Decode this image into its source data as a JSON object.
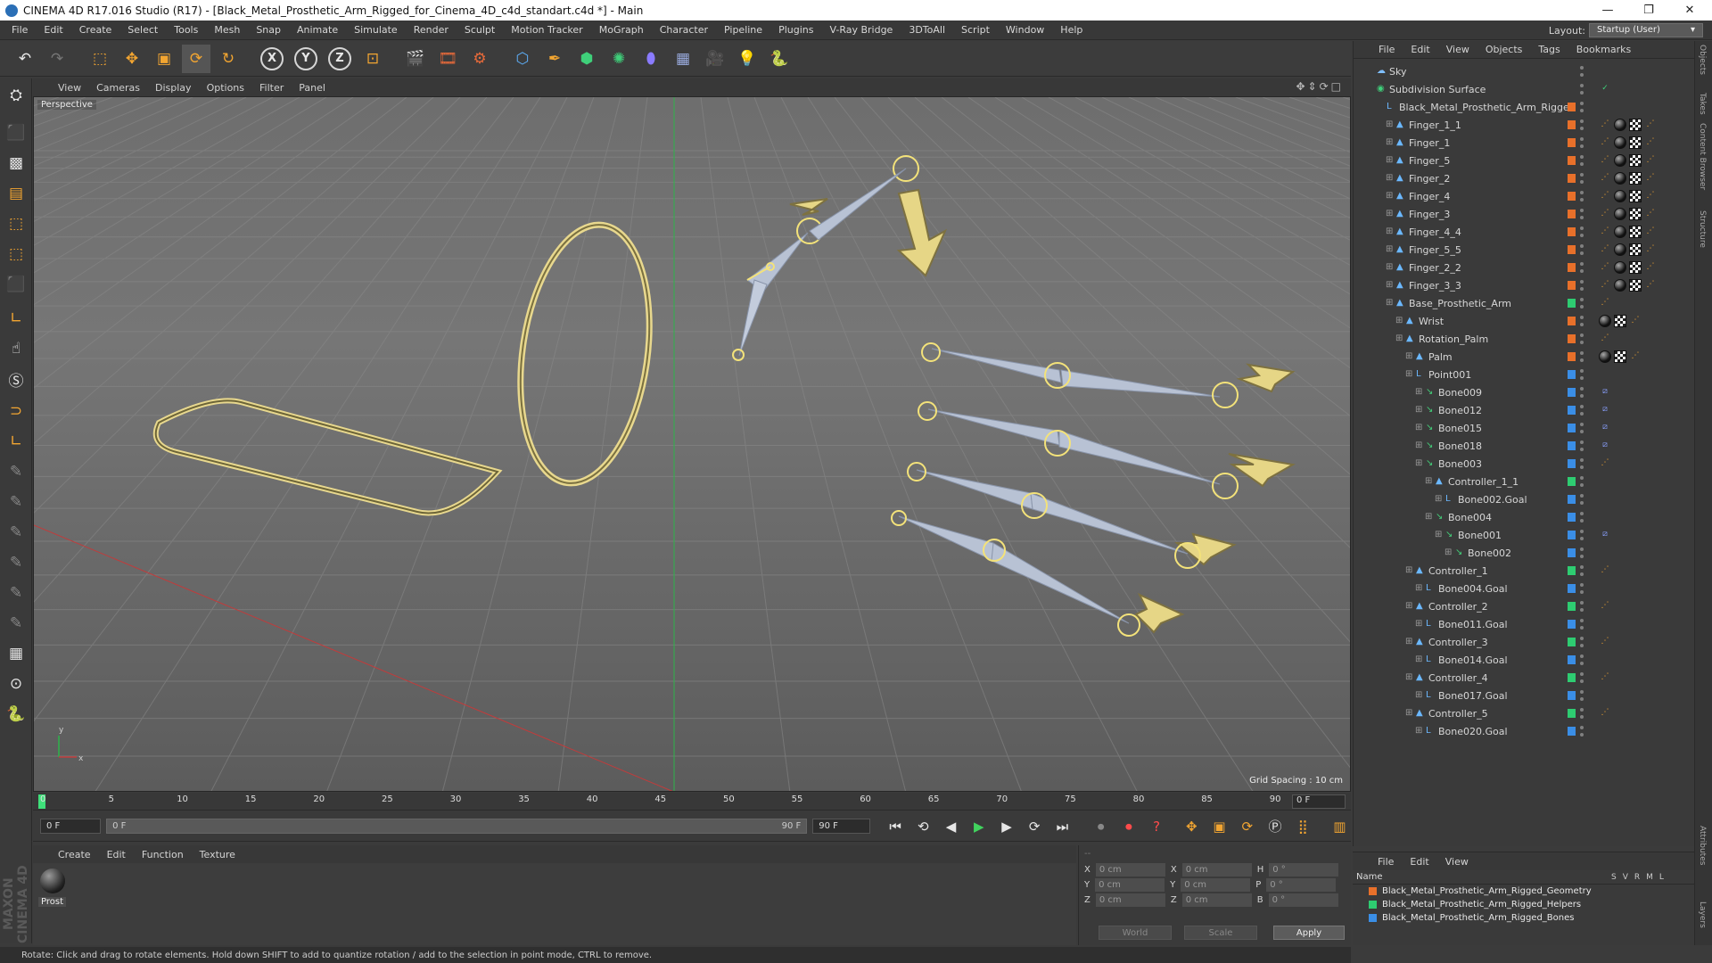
{
  "window": {
    "title": "CINEMA 4D R17.016 Studio (R17) - [Black_Metal_Prosthetic_Arm_Rigged_for_Cinema_4D_c4d_standart.c4d *] - Main",
    "controls": [
      "—",
      "❐",
      "✕"
    ]
  },
  "menubar": [
    "File",
    "Edit",
    "Create",
    "Select",
    "Tools",
    "Mesh",
    "Snap",
    "Animate",
    "Simulate",
    "Render",
    "Sculpt",
    "Motion Tracker",
    "MoGraph",
    "Character",
    "Pipeline",
    "Plugins",
    "V-Ray Bridge",
    "3DToAll",
    "Script",
    "Window",
    "Help"
  ],
  "layout": {
    "label": "Layout:",
    "value": "Startup (User)"
  },
  "toolbar": {
    "icons": [
      "undo-icon",
      "redo-icon",
      "select-icon",
      "move-icon",
      "scale-icon",
      "rotate-icon",
      "rotate-alt-icon",
      "x-axis-icon",
      "y-axis-icon",
      "z-axis-icon",
      "coordinate-system-icon",
      "render-view-icon",
      "render-picture-viewer-icon",
      "render-settings-icon",
      "cube-icon",
      "pen-icon",
      "subdivide-icon",
      "array-icon",
      "deformer-icon",
      "floor-icon",
      "camera-icon",
      "light-icon",
      "python-icon"
    ],
    "axis": {
      "x": "X",
      "y": "Y",
      "z": "Z"
    }
  },
  "viewport_menu": [
    "View",
    "Cameras",
    "Display",
    "Options",
    "Filter",
    "Panel"
  ],
  "viewport": {
    "label": "Perspective",
    "grid_spacing": "Grid Spacing : 10 cm"
  },
  "timeline": {
    "ticks": [
      "0",
      "5",
      "10",
      "15",
      "20",
      "25",
      "30",
      "35",
      "40",
      "45",
      "50",
      "55",
      "60",
      "65",
      "70",
      "75",
      "80",
      "85",
      "90"
    ],
    "current": "0 F"
  },
  "transport": {
    "start": "0 F",
    "slider_start": "0 F",
    "slider_end": "90 F",
    "end": "90 F"
  },
  "material_menu": [
    "Create",
    "Edit",
    "Function",
    "Texture"
  ],
  "material": {
    "name": "Prost"
  },
  "coords": {
    "rows": [
      {
        "a": "X",
        "av": "0 cm",
        "b": "X",
        "bv": "0 cm",
        "c": "H",
        "cv": "0 °"
      },
      {
        "a": "Y",
        "av": "0 cm",
        "b": "Y",
        "bv": "0 cm",
        "c": "P",
        "cv": "0 °"
      },
      {
        "a": "Z",
        "av": "0 cm",
        "b": "Z",
        "bv": "0 cm",
        "c": "B",
        "cv": "0 °"
      }
    ],
    "space": "World",
    "mode": "Scale",
    "apply": "Apply",
    "header": "--"
  },
  "status": "Rotate: Click and drag to rotate elements. Hold down SHIFT to add to quantize rotation / add to the selection in point mode, CTRL to remove.",
  "object_manager": {
    "menu": [
      "File",
      "Edit",
      "View",
      "Objects",
      "Tags",
      "Bookmarks"
    ],
    "rows": [
      {
        "name": "Sky",
        "depth": 0,
        "type": "sky",
        "layer": "",
        "tags": []
      },
      {
        "name": "Subdivision Surface",
        "depth": 0,
        "type": "sds",
        "layer": "",
        "tags": [
          "check"
        ]
      },
      {
        "name": "Black_Metal_Prosthetic_Arm_Rigged",
        "depth": 1,
        "type": "null",
        "layer": "#e8702a",
        "tags": []
      },
      {
        "name": "Finger_1_1",
        "depth": 2,
        "type": "joint",
        "layer": "#e8702a",
        "tags": [
          "ik",
          "ball",
          "chk",
          "ik"
        ]
      },
      {
        "name": "Finger_1",
        "depth": 2,
        "type": "joint",
        "layer": "#e8702a",
        "tags": [
          "ik",
          "ball",
          "chk",
          "ik"
        ]
      },
      {
        "name": "Finger_5",
        "depth": 2,
        "type": "joint",
        "layer": "#e8702a",
        "tags": [
          "ik",
          "ball",
          "chk",
          "ik"
        ]
      },
      {
        "name": "Finger_2",
        "depth": 2,
        "type": "joint",
        "layer": "#e8702a",
        "tags": [
          "ik",
          "ball",
          "chk",
          "ik"
        ]
      },
      {
        "name": "Finger_4",
        "depth": 2,
        "type": "joint",
        "layer": "#e8702a",
        "tags": [
          "ik",
          "ball",
          "chk",
          "ik"
        ]
      },
      {
        "name": "Finger_3",
        "depth": 2,
        "type": "joint",
        "layer": "#e8702a",
        "tags": [
          "ik",
          "ball",
          "chk",
          "ik"
        ]
      },
      {
        "name": "Finger_4_4",
        "depth": 2,
        "type": "joint",
        "layer": "#e8702a",
        "tags": [
          "ik",
          "ball",
          "chk",
          "ik"
        ]
      },
      {
        "name": "Finger_5_5",
        "depth": 2,
        "type": "joint",
        "layer": "#e8702a",
        "tags": [
          "ik",
          "ball",
          "chk",
          "ik"
        ]
      },
      {
        "name": "Finger_2_2",
        "depth": 2,
        "type": "joint",
        "layer": "#e8702a",
        "tags": [
          "ik",
          "ball",
          "chk",
          "ik"
        ]
      },
      {
        "name": "Finger_3_3",
        "depth": 2,
        "type": "joint",
        "layer": "#e8702a",
        "tags": [
          "ik",
          "ball",
          "chk",
          "ik"
        ]
      },
      {
        "name": "Base_Prosthetic_Arm",
        "depth": 2,
        "type": "joint",
        "layer": "#2ecc71",
        "tags": [
          "ik"
        ]
      },
      {
        "name": "Wrist",
        "depth": 3,
        "type": "joint",
        "layer": "#e8702a",
        "tags": [
          "ball",
          "chk",
          "ik"
        ]
      },
      {
        "name": "Rotation_Palm",
        "depth": 3,
        "type": "joint",
        "layer": "#e8702a",
        "tags": [
          "ik"
        ]
      },
      {
        "name": "Palm",
        "depth": 4,
        "type": "joint",
        "layer": "#e8702a",
        "tags": [
          "ball",
          "chk",
          "ik"
        ]
      },
      {
        "name": "Point001",
        "depth": 4,
        "type": "null",
        "layer": "#3a8ee6",
        "tags": []
      },
      {
        "name": "Bone009",
        "depth": 5,
        "type": "bone",
        "layer": "#3a8ee6",
        "tags": [
          "wt"
        ]
      },
      {
        "name": "Bone012",
        "depth": 5,
        "type": "bone",
        "layer": "#3a8ee6",
        "tags": [
          "wt"
        ]
      },
      {
        "name": "Bone015",
        "depth": 5,
        "type": "bone",
        "layer": "#3a8ee6",
        "tags": [
          "wt"
        ]
      },
      {
        "name": "Bone018",
        "depth": 5,
        "type": "bone",
        "layer": "#3a8ee6",
        "tags": [
          "wt"
        ]
      },
      {
        "name": "Bone003",
        "depth": 5,
        "type": "bone",
        "layer": "#3a8ee6",
        "tags": [
          "ik"
        ]
      },
      {
        "name": "Controller_1_1",
        "depth": 6,
        "type": "joint",
        "layer": "#2ecc71",
        "tags": []
      },
      {
        "name": "Bone002.Goal",
        "depth": 7,
        "type": "null",
        "layer": "#3a8ee6",
        "tags": []
      },
      {
        "name": "Bone004",
        "depth": 6,
        "type": "bone",
        "layer": "#3a8ee6",
        "tags": []
      },
      {
        "name": "Bone001",
        "depth": 7,
        "type": "bone",
        "layer": "#3a8ee6",
        "tags": [
          "wt"
        ]
      },
      {
        "name": "Bone002",
        "depth": 8,
        "type": "bone",
        "layer": "#3a8ee6",
        "tags": []
      },
      {
        "name": "Controller_1",
        "depth": 4,
        "type": "joint",
        "layer": "#2ecc71",
        "tags": [
          "ik"
        ]
      },
      {
        "name": "Bone004.Goal",
        "depth": 5,
        "type": "null",
        "layer": "#3a8ee6",
        "tags": []
      },
      {
        "name": "Controller_2",
        "depth": 4,
        "type": "joint",
        "layer": "#2ecc71",
        "tags": [
          "ik"
        ]
      },
      {
        "name": "Bone011.Goal",
        "depth": 5,
        "type": "null",
        "layer": "#3a8ee6",
        "tags": []
      },
      {
        "name": "Controller_3",
        "depth": 4,
        "type": "joint",
        "layer": "#2ecc71",
        "tags": [
          "ik"
        ]
      },
      {
        "name": "Bone014.Goal",
        "depth": 5,
        "type": "null",
        "layer": "#3a8ee6",
        "tags": []
      },
      {
        "name": "Controller_4",
        "depth": 4,
        "type": "joint",
        "layer": "#2ecc71",
        "tags": [
          "ik"
        ]
      },
      {
        "name": "Bone017.Goal",
        "depth": 5,
        "type": "null",
        "layer": "#3a8ee6",
        "tags": []
      },
      {
        "name": "Controller_5",
        "depth": 4,
        "type": "joint",
        "layer": "#2ecc71",
        "tags": [
          "ik"
        ]
      },
      {
        "name": "Bone020.Goal",
        "depth": 5,
        "type": "null",
        "layer": "#3a8ee6",
        "tags": []
      }
    ]
  },
  "layer_manager": {
    "menu": [
      "File",
      "Edit",
      "View"
    ],
    "header": {
      "name": "Name",
      "cols": [
        "S",
        "V",
        "R",
        "M",
        "L"
      ]
    },
    "layers": [
      {
        "name": "Black_Metal_Prosthetic_Arm_Rigged_Geometry",
        "color": "#e8702a"
      },
      {
        "name": "Black_Metal_Prosthetic_Arm_Rigged_Helpers",
        "color": "#2ecc71"
      },
      {
        "name": "Black_Metal_Prosthetic_Arm_Rigged_Bones",
        "color": "#3a8ee6"
      }
    ]
  },
  "side_tabs": [
    "Objects",
    "Takes",
    "Content Browser",
    "Structure",
    "Attributes",
    "Layers"
  ]
}
